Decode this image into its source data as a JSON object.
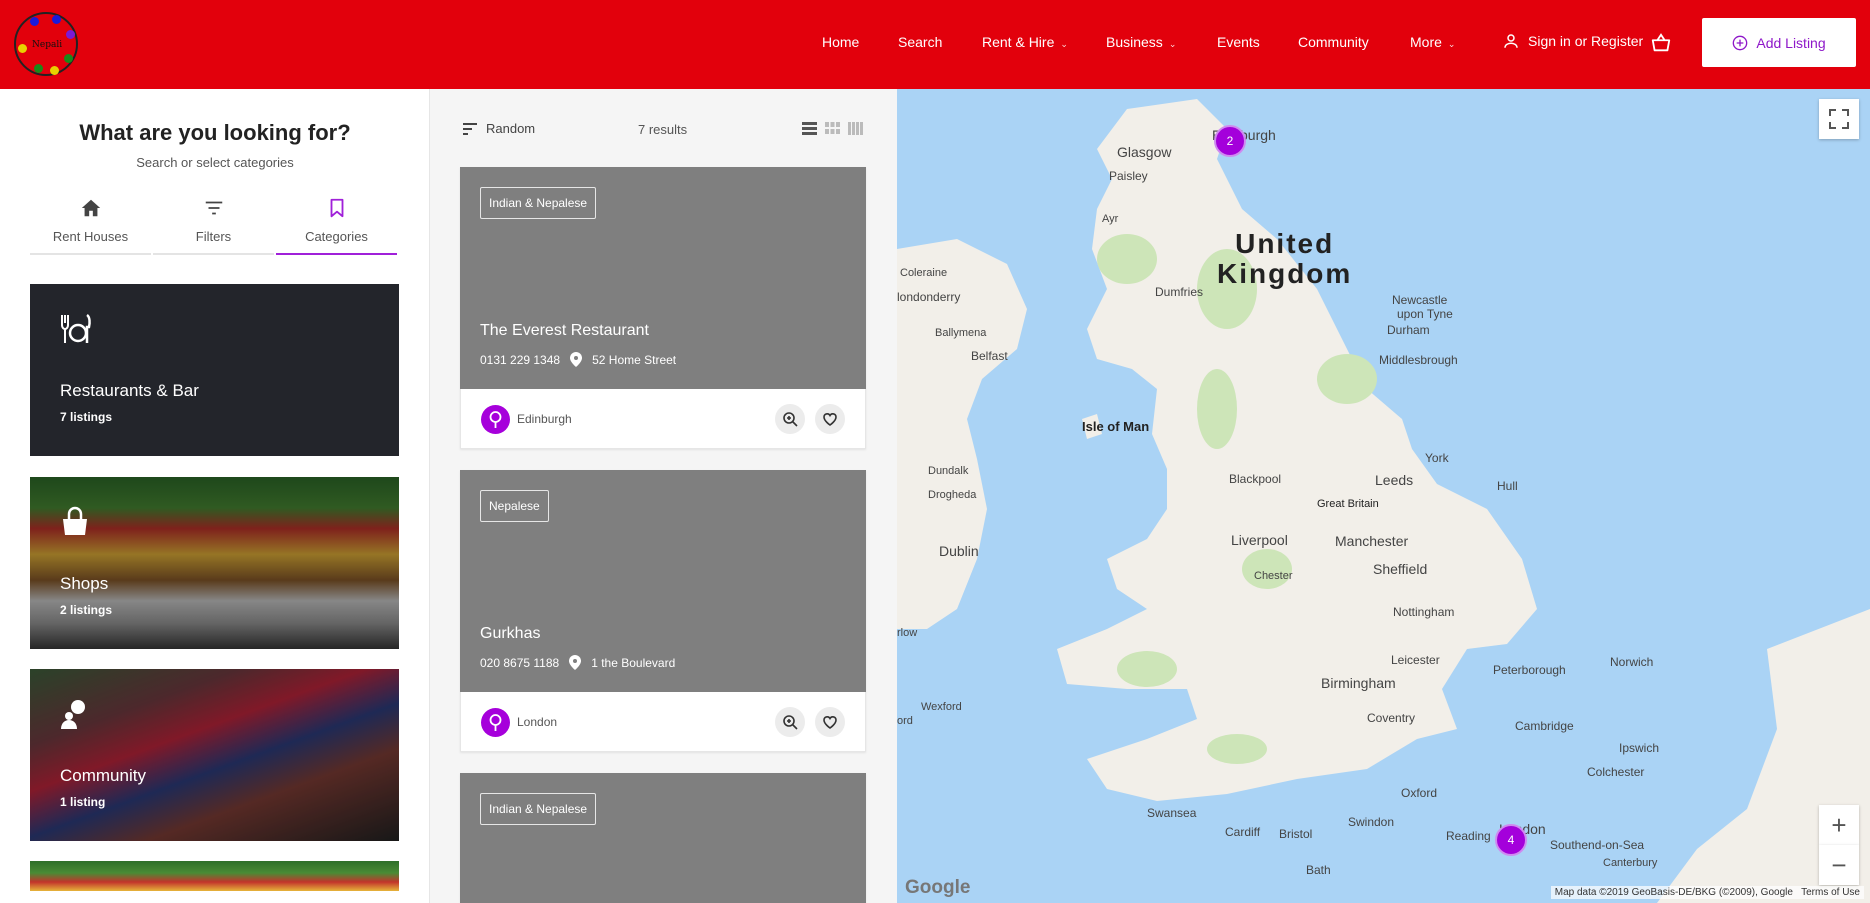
{
  "header": {
    "logo_text": "Nepali",
    "nav": [
      {
        "label": "Home",
        "dropdown": false
      },
      {
        "label": "Search",
        "dropdown": false
      },
      {
        "label": "Rent & Hire",
        "dropdown": true
      },
      {
        "label": "Business",
        "dropdown": true
      },
      {
        "label": "Events",
        "dropdown": false
      },
      {
        "label": "Community",
        "dropdown": false
      },
      {
        "label": "More",
        "dropdown": true
      }
    ],
    "signin_label": "Sign in or Register",
    "add_listing_label": "Add Listing",
    "brand_color": "#e2000c",
    "accent_color": "#a020d9"
  },
  "sidebar": {
    "title": "What are you looking for?",
    "subtitle": "Search or select categories",
    "tabs": [
      {
        "label": "Rent Houses",
        "icon": "home-icon",
        "active": false
      },
      {
        "label": "Filters",
        "icon": "filter-icon",
        "active": false
      },
      {
        "label": "Categories",
        "icon": "bookmark-icon",
        "active": true
      }
    ],
    "categories": [
      {
        "name": "Restaurants & Bar",
        "count": "7 listings",
        "icon": "dining-icon"
      },
      {
        "name": "Shops",
        "count": "2 listings",
        "icon": "shopping-bag-icon"
      },
      {
        "name": "Community",
        "count": "1 listing",
        "icon": "community-icon"
      }
    ]
  },
  "listings": {
    "sort_label": "Random",
    "results_label": "7 results",
    "cards": [
      {
        "tag": "Indian & Nepalese",
        "title": "The Everest Restaurant",
        "phone": "0131 229 1348",
        "address": "52 Home Street",
        "city": "Edinburgh"
      },
      {
        "tag": "Nepalese",
        "title": "Gurkhas",
        "phone": "020 8675 1188",
        "address": "1 the Boulevard",
        "city": "London"
      },
      {
        "tag": "Indian & Nepalese",
        "title": "",
        "phone": "",
        "address": "",
        "city": ""
      }
    ]
  },
  "map": {
    "country_label_1": "United",
    "country_label_2": "Kingdom",
    "places": [
      "Glasgow",
      "Edinburgh",
      "Paisley",
      "Ayr",
      "Dumfries",
      "Newcastle",
      "upon Tyne",
      "Durham",
      "Middlesbrough",
      "Coleraine",
      "londonderry",
      "Ballymena",
      "Belfast",
      "Isle of Man",
      "Dundalk",
      "Drogheda",
      "Dublin",
      "York",
      "Hull",
      "Blackpool",
      "Leeds",
      "Great Britain",
      "Liverpool",
      "Manchester",
      "Chester",
      "Sheffield",
      "Nottingham",
      "Leicester",
      "Peterborough",
      "Norwich",
      "Birmingham",
      "Wexford",
      "Coventry",
      "Cambridge",
      "Ipswich",
      "Colchester",
      "Oxford",
      "Swansea",
      "Cardiff",
      "Bristol",
      "Swindon",
      "Reading",
      "London",
      "Southend-on-Sea",
      "Canterbury",
      "Bath",
      "rlow",
      "ord"
    ],
    "clusters": [
      "2",
      "4"
    ],
    "credit": "Map data ©2019 GeoBasis-DE/BKG (©2009), Google",
    "terms": "Terms of Use",
    "google": "Google",
    "zoom_in": "+",
    "zoom_out": "−"
  }
}
